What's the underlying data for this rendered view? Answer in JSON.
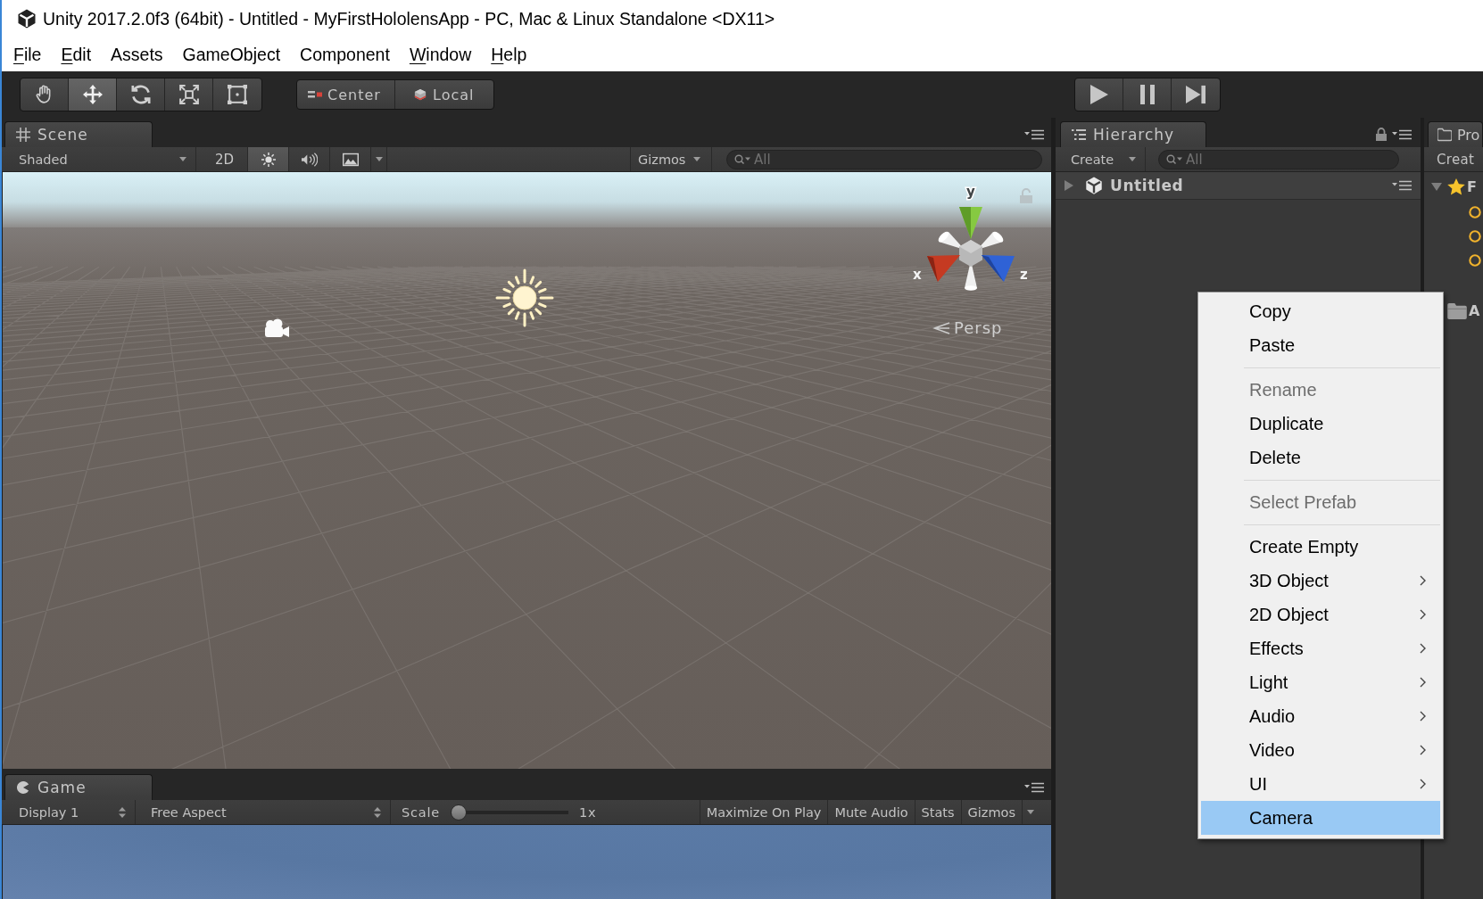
{
  "window": {
    "title": "Unity 2017.2.0f3 (64bit) - Untitled - MyFirstHololensApp - PC, Mac & Linux Standalone <DX11>"
  },
  "menu_bar": [
    {
      "label": "File",
      "mnemonic_underlined": true
    },
    {
      "label": "Edit",
      "mnemonic_underlined": true
    },
    {
      "label": "Assets",
      "mnemonic_underlined": false
    },
    {
      "label": "GameObject",
      "mnemonic_underlined": false
    },
    {
      "label": "Component",
      "mnemonic_underlined": false
    },
    {
      "label": "Window",
      "mnemonic_underlined": true
    },
    {
      "label": "Help",
      "mnemonic_underlined": true
    }
  ],
  "toolbar": {
    "tools": [
      {
        "kind": "hand",
        "selected": false
      },
      {
        "kind": "move",
        "selected": true
      },
      {
        "kind": "rotate",
        "selected": false
      },
      {
        "kind": "scale",
        "selected": false
      },
      {
        "kind": "rect",
        "selected": false
      }
    ],
    "pivot": [
      {
        "kind": "position",
        "label": "Center"
      },
      {
        "kind": "rotation",
        "label": "Local"
      }
    ],
    "playback": [
      {
        "kind": "play"
      },
      {
        "kind": "pause"
      },
      {
        "kind": "step"
      }
    ]
  },
  "scene": {
    "tab": "Scene",
    "shading": "Shaded",
    "toggles": [
      {
        "kind": "dimension",
        "label": "2D",
        "on": false
      },
      {
        "kind": "lighting",
        "on": true
      },
      {
        "kind": "audio",
        "on": false
      },
      {
        "kind": "effects",
        "on": false
      }
    ],
    "gizmos": "Gizmos",
    "search": {
      "placeholder": "All"
    },
    "view": {
      "axes": [
        {
          "label": "y"
        },
        {
          "label": "x"
        },
        {
          "label": "z"
        }
      ],
      "projection": "Persp"
    }
  },
  "game": {
    "tab": "Game",
    "display": "Display 1",
    "aspect": "Free Aspect",
    "scale": {
      "label": "Scale",
      "level": 0,
      "reading": "1x"
    },
    "buttons": [
      {
        "kind": "toggle",
        "label": "Maximize On Play"
      },
      {
        "kind": "toggle",
        "label": "Mute Audio"
      },
      {
        "kind": "toggle",
        "label": "Stats"
      },
      {
        "kind": "dropdown",
        "label": "Gizmos"
      }
    ]
  },
  "hierarchy": {
    "tab": "Hierarchy",
    "create": "Create",
    "search": {
      "placeholder": "All"
    },
    "scenes": [
      {
        "label": "Untitled",
        "expanded": false
      }
    ]
  },
  "project": {
    "tab": "Pro",
    "create": "Creat",
    "tree": [
      {
        "kind": "favorites",
        "label": "F",
        "expanded": true,
        "children": [
          {
            "kind": "search"
          },
          {
            "kind": "search"
          },
          {
            "kind": "search"
          }
        ]
      },
      {
        "kind": "folder",
        "label": "A"
      }
    ]
  },
  "context_menu": {
    "items": [
      {
        "kind": "item",
        "label": "Copy",
        "disabled": false,
        "submenu": false,
        "selected": false
      },
      {
        "kind": "item",
        "label": "Paste",
        "disabled": false,
        "submenu": false,
        "selected": false
      },
      {
        "kind": "separator"
      },
      {
        "kind": "item",
        "label": "Rename",
        "disabled": true,
        "submenu": false,
        "selected": false
      },
      {
        "kind": "item",
        "label": "Duplicate",
        "disabled": false,
        "submenu": false,
        "selected": false
      },
      {
        "kind": "item",
        "label": "Delete",
        "disabled": false,
        "submenu": false,
        "selected": false
      },
      {
        "kind": "separator"
      },
      {
        "kind": "item",
        "label": "Select Prefab",
        "disabled": true,
        "submenu": false,
        "selected": false
      },
      {
        "kind": "separator"
      },
      {
        "kind": "item",
        "label": "Create Empty",
        "disabled": false,
        "submenu": false,
        "selected": false
      },
      {
        "kind": "item",
        "label": "3D Object",
        "disabled": false,
        "submenu": true,
        "selected": false
      },
      {
        "kind": "item",
        "label": "2D Object",
        "disabled": false,
        "submenu": true,
        "selected": false
      },
      {
        "kind": "item",
        "label": "Effects",
        "disabled": false,
        "submenu": true,
        "selected": false
      },
      {
        "kind": "item",
        "label": "Light",
        "disabled": false,
        "submenu": true,
        "selected": false
      },
      {
        "kind": "item",
        "label": "Audio",
        "disabled": false,
        "submenu": true,
        "selected": false
      },
      {
        "kind": "item",
        "label": "Video",
        "disabled": false,
        "submenu": true,
        "selected": false
      },
      {
        "kind": "item",
        "label": "UI",
        "disabled": false,
        "submenu": true,
        "selected": false
      },
      {
        "kind": "item",
        "label": "Camera",
        "disabled": false,
        "submenu": false,
        "selected": true
      }
    ]
  }
}
